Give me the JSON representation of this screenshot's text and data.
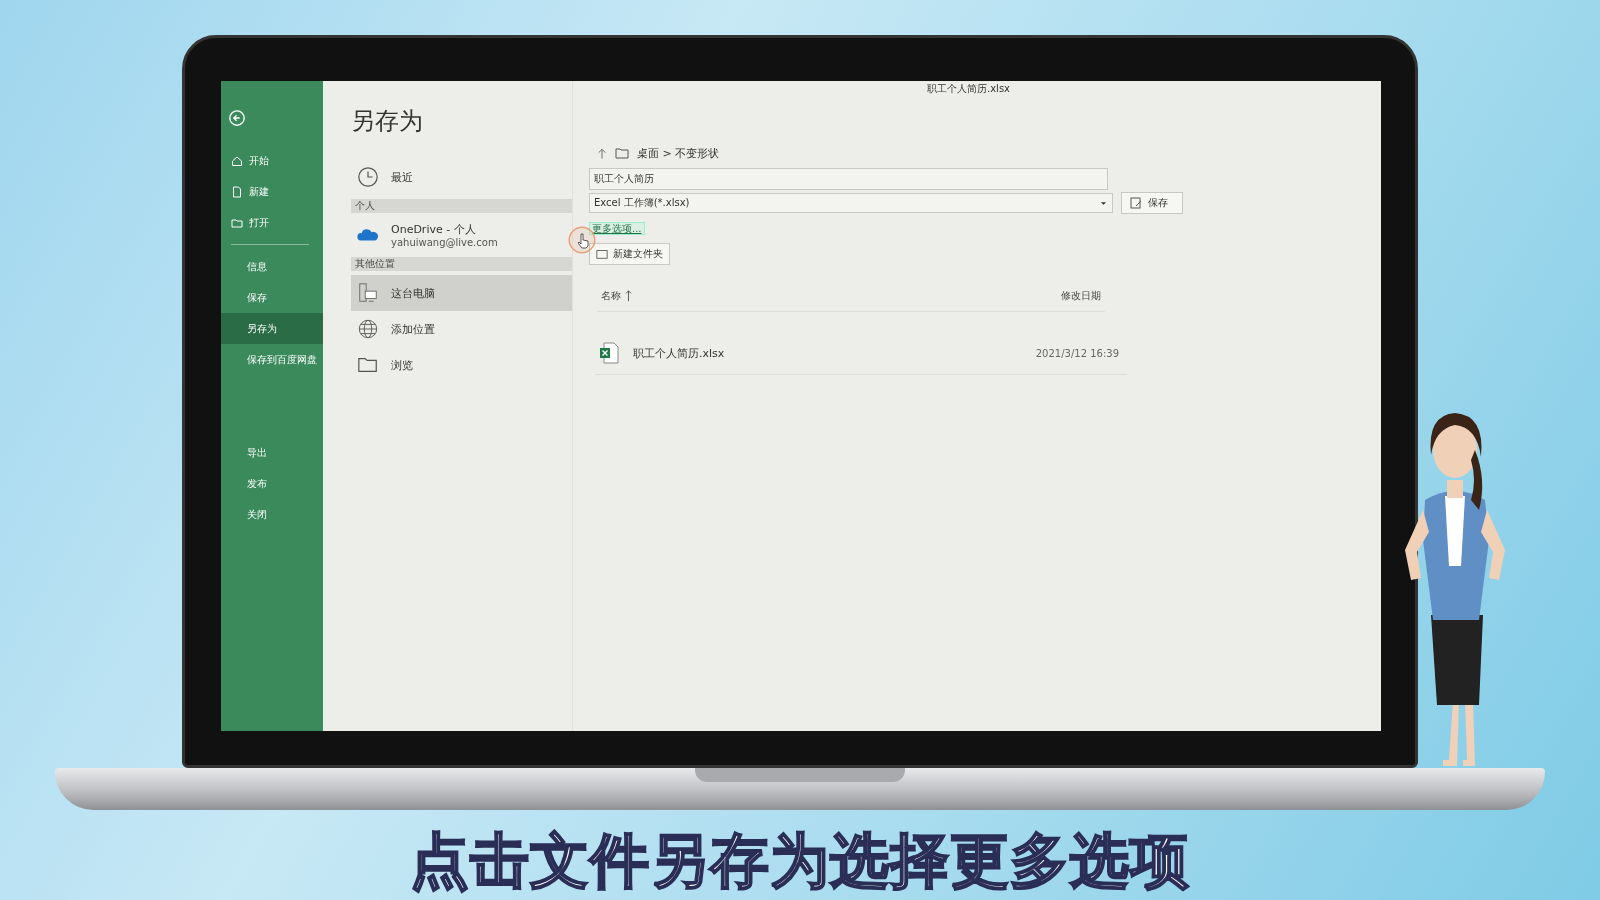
{
  "window": {
    "title": "职工个人简历.xlsx"
  },
  "sidebar": {
    "items": [
      {
        "label": "开始",
        "selected": false
      },
      {
        "label": "新建",
        "selected": false
      },
      {
        "label": "打开",
        "selected": false
      },
      {
        "label": "信息",
        "selected": false
      },
      {
        "label": "保存",
        "selected": false
      },
      {
        "label": "另存为",
        "selected": true
      },
      {
        "label": "保存到百度网盘",
        "selected": false
      },
      {
        "label": "导出",
        "selected": false
      },
      {
        "label": "发布",
        "selected": false
      },
      {
        "label": "关闭",
        "selected": false
      }
    ]
  },
  "page_title": "另存为",
  "locations": [
    {
      "kind": "item",
      "label": "最近",
      "selected": false
    },
    {
      "kind": "header",
      "label": "个人"
    },
    {
      "kind": "item",
      "label": "OneDrive - 个人",
      "sub": "yahuiwang@live.com",
      "selected": false
    },
    {
      "kind": "header",
      "label": "其他位置"
    },
    {
      "kind": "item",
      "label": "这台电脑",
      "selected": true
    },
    {
      "kind": "item",
      "label": "添加位置",
      "selected": false
    },
    {
      "kind": "item",
      "label": "浏览",
      "selected": false
    }
  ],
  "save_panel": {
    "breadcrumb": "桌面 > 不变形状",
    "file_name": "职工个人简历",
    "file_type": "Excel 工作簿(*.xlsx)",
    "save_button": "保存",
    "more_options": "更多选项...",
    "new_folder_button": "新建文件夹",
    "columns": [
      "名称",
      "修改日期"
    ],
    "rows": [
      {
        "name": "职工个人简历.xlsx",
        "modified": "2021/3/12 16:39"
      }
    ]
  },
  "caption": "点击文件另存为选择更多选项"
}
